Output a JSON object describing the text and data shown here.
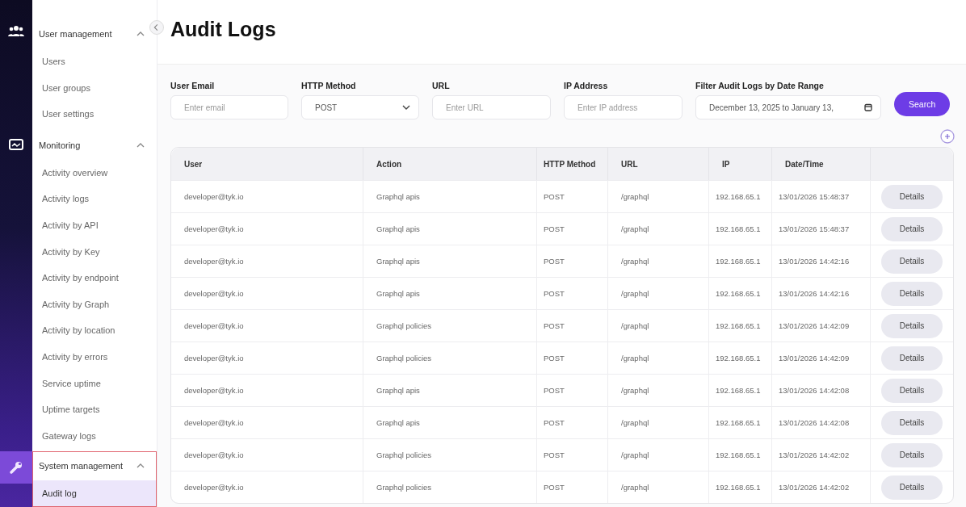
{
  "rail": [
    {
      "kind": "users",
      "selected": false
    },
    {
      "kind": "monitor",
      "selected": false
    },
    {
      "kind": "wrench",
      "selected": true
    }
  ],
  "sidebar": {
    "sections": [
      {
        "label": "User management",
        "expanded": true,
        "selected": false,
        "items": [
          {
            "label": "Users",
            "selected": false
          },
          {
            "label": "User groups",
            "selected": false
          },
          {
            "label": "User settings",
            "selected": false
          }
        ]
      },
      {
        "label": "Monitoring",
        "expanded": true,
        "selected": false,
        "items": [
          {
            "label": "Activity overview",
            "selected": false
          },
          {
            "label": "Activity logs",
            "selected": false
          },
          {
            "label": "Activity by API",
            "selected": false
          },
          {
            "label": "Activity by Key",
            "selected": false
          },
          {
            "label": "Activity by endpoint",
            "selected": false
          },
          {
            "label": "Activity by Graph",
            "selected": false
          },
          {
            "label": "Activity by location",
            "selected": false
          },
          {
            "label": "Activity by errors",
            "selected": false
          },
          {
            "label": "Service uptime",
            "selected": false
          },
          {
            "label": "Uptime targets",
            "selected": false
          },
          {
            "label": "Gateway logs",
            "selected": false
          }
        ]
      },
      {
        "label": "System management",
        "expanded": true,
        "selected": true,
        "items": [
          {
            "label": "Audit log",
            "selected": true
          }
        ]
      }
    ]
  },
  "page": {
    "title": "Audit Logs"
  },
  "filters": [
    {
      "kind": "text",
      "label": "User Email",
      "placeholder": "Enter email"
    },
    {
      "kind": "select",
      "label": "HTTP Method",
      "value": "POST"
    },
    {
      "kind": "text",
      "label": "URL",
      "placeholder": "Enter URL"
    },
    {
      "kind": "text",
      "label": "IP Address",
      "placeholder": "Enter IP address"
    },
    {
      "kind": "date",
      "label": "Filter Audit Logs by Date Range",
      "value": "December 13, 2025 to January 13,"
    }
  ],
  "search_button": "Search",
  "table": {
    "columns": [
      "User",
      "Action",
      "HTTP Method",
      "URL",
      "IP",
      "Date/Time"
    ],
    "rows": [
      {
        "user": "developer@tyk.io",
        "action": "Graphql apis",
        "method": "POST",
        "url": "/graphql",
        "ip": "192.168.65.1",
        "datetime": "13/01/2026 15:48:37",
        "button": "Details"
      },
      {
        "user": "developer@tyk.io",
        "action": "Graphql apis",
        "method": "POST",
        "url": "/graphql",
        "ip": "192.168.65.1",
        "datetime": "13/01/2026 15:48:37",
        "button": "Details"
      },
      {
        "user": "developer@tyk.io",
        "action": "Graphql apis",
        "method": "POST",
        "url": "/graphql",
        "ip": "192.168.65.1",
        "datetime": "13/01/2026 14:42:16",
        "button": "Details"
      },
      {
        "user": "developer@tyk.io",
        "action": "Graphql apis",
        "method": "POST",
        "url": "/graphql",
        "ip": "192.168.65.1",
        "datetime": "13/01/2026 14:42:16",
        "button": "Details"
      },
      {
        "user": "developer@tyk.io",
        "action": "Graphql policies",
        "method": "POST",
        "url": "/graphql",
        "ip": "192.168.65.1",
        "datetime": "13/01/2026 14:42:09",
        "button": "Details"
      },
      {
        "user": "developer@tyk.io",
        "action": "Graphql policies",
        "method": "POST",
        "url": "/graphql",
        "ip": "192.168.65.1",
        "datetime": "13/01/2026 14:42:09",
        "button": "Details"
      },
      {
        "user": "developer@tyk.io",
        "action": "Graphql apis",
        "method": "POST",
        "url": "/graphql",
        "ip": "192.168.65.1",
        "datetime": "13/01/2026 14:42:08",
        "button": "Details"
      },
      {
        "user": "developer@tyk.io",
        "action": "Graphql apis",
        "method": "POST",
        "url": "/graphql",
        "ip": "192.168.65.1",
        "datetime": "13/01/2026 14:42:08",
        "button": "Details"
      },
      {
        "user": "developer@tyk.io",
        "action": "Graphql policies",
        "method": "POST",
        "url": "/graphql",
        "ip": "192.168.65.1",
        "datetime": "13/01/2026 14:42:02",
        "button": "Details"
      },
      {
        "user": "developer@tyk.io",
        "action": "Graphql policies",
        "method": "POST",
        "url": "/graphql",
        "ip": "192.168.65.1",
        "datetime": "13/01/2026 14:42:02",
        "button": "Details"
      }
    ]
  }
}
